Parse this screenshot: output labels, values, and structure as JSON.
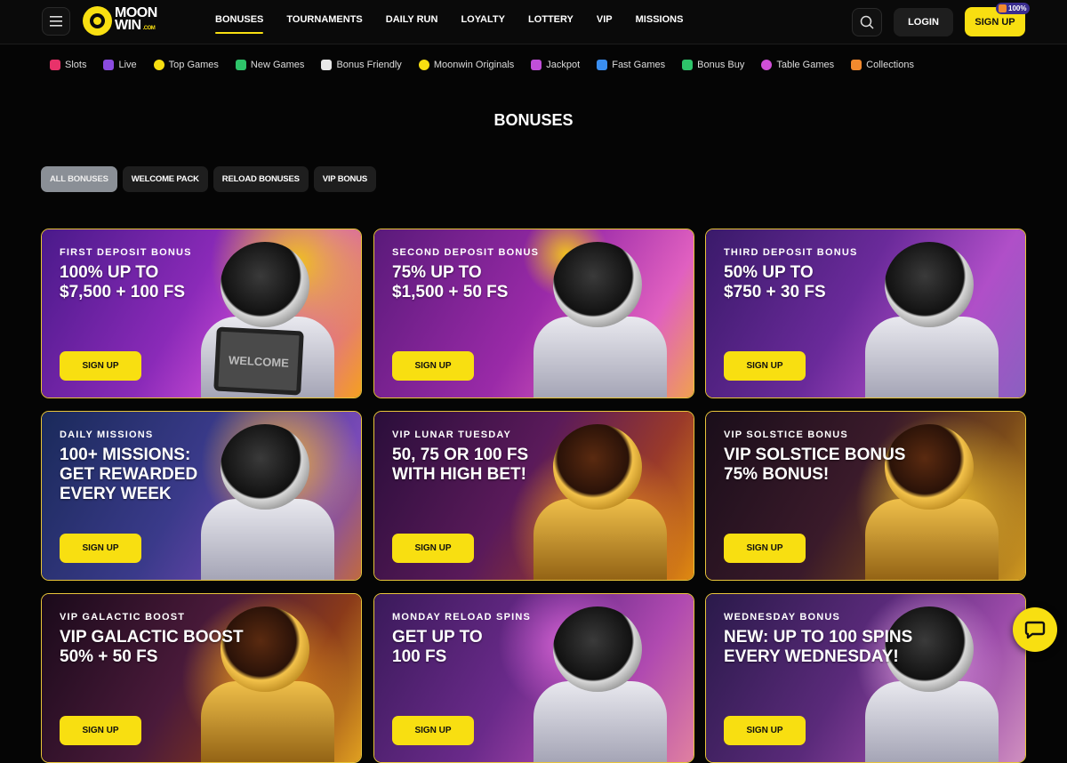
{
  "header": {
    "logo_line1": "MOON",
    "logo_line2": "WIN",
    "logo_suffix": ".COM",
    "nav": [
      {
        "label": "BONUSES",
        "active": true
      },
      {
        "label": "TOURNAMENTS"
      },
      {
        "label": "DAILY RUN"
      },
      {
        "label": "LOYALTY"
      },
      {
        "label": "LOTTERY"
      },
      {
        "label": "VIP"
      },
      {
        "label": "MISSIONS"
      }
    ],
    "login_label": "LOGIN",
    "signup_label": "SIGN UP",
    "signup_badge": "100%"
  },
  "categories": [
    {
      "label": "Slots",
      "icon": "slots-icon",
      "color": "#e8326a"
    },
    {
      "label": "Live",
      "icon": "live-icon",
      "color": "#8a4be0"
    },
    {
      "label": "Top Games",
      "icon": "top-games-icon",
      "color": "#f8df11"
    },
    {
      "label": "New Games",
      "icon": "new-games-icon",
      "color": "#2ec46a"
    },
    {
      "label": "Bonus Friendly",
      "icon": "bonus-friendly-icon",
      "color": "#e8e8e8"
    },
    {
      "label": "Moonwin Originals",
      "icon": "moonwin-originals-icon",
      "color": "#f8df11"
    },
    {
      "label": "Jackpot",
      "icon": "jackpot-icon",
      "color": "#c04fd8"
    },
    {
      "label": "Fast Games",
      "icon": "fast-games-icon",
      "color": "#3a8ef0"
    },
    {
      "label": "Bonus Buy",
      "icon": "bonus-buy-icon",
      "color": "#2ec46a"
    },
    {
      "label": "Table Games",
      "icon": "table-games-icon",
      "color": "#d04fd8"
    },
    {
      "label": "Collections",
      "icon": "collections-icon",
      "color": "#f28a2e"
    }
  ],
  "page_title": "BONUSES",
  "filters": [
    {
      "label": "ALL BONUSES",
      "active": true
    },
    {
      "label": "WELCOME PACK"
    },
    {
      "label": "RELOAD BONUSES"
    },
    {
      "label": "VIP BONUS"
    }
  ],
  "cards": [
    {
      "label": "FIRST DEPOSIT BONUS",
      "title_line1": "100% UP TO",
      "title_line2": "$7,500 + 100 FS",
      "title_line3": "",
      "cta": "SIGN UP",
      "sign": "WELCOME"
    },
    {
      "label": "SECOND DEPOSIT BONUS",
      "title_line1": "75% UP TO",
      "title_line2": "$1,500 + 50 FS",
      "title_line3": "",
      "cta": "SIGN UP"
    },
    {
      "label": "THIRD DEPOSIT BONUS",
      "title_line1": "50% UP TO",
      "title_line2": "$750 + 30 FS",
      "title_line3": "",
      "cta": "SIGN UP"
    },
    {
      "label": "DAILY MISSIONS",
      "title_line1": "100+ MISSIONS:",
      "title_line2": "GET REWARDED",
      "title_line3": "EVERY WEEK",
      "cta": "SIGN UP"
    },
    {
      "label": "VIP LUNAR TUESDAY",
      "title_line1": "50, 75 OR 100 FS",
      "title_line2": "WITH HIGH BET!",
      "title_line3": "",
      "cta": "SIGN UP"
    },
    {
      "label": "VIP SOLSTICE BONUS",
      "title_line1": "VIP SOLSTICE BONUS",
      "title_line2": "75% BONUS!",
      "title_line3": "",
      "cta": "SIGN UP"
    },
    {
      "label": "VIP GALACTIC BOOST",
      "title_line1": "VIP GALACTIC BOOST",
      "title_line2": "50% + 50 FS",
      "title_line3": "",
      "cta": "SIGN UP"
    },
    {
      "label": "MONDAY RELOAD SPINS",
      "title_line1": "GET UP TO",
      "title_line2": "100 FS",
      "title_line3": "",
      "cta": "SIGN UP"
    },
    {
      "label": "WEDNESDAY BONUS",
      "title_line1": "NEW: UP TO 100 SPINS",
      "title_line2": "EVERY WEDNESDAY!",
      "title_line3": "",
      "cta": "SIGN UP"
    }
  ],
  "colors": {
    "accent": "#f8df11",
    "background": "#050505",
    "card_border": "#e8c53a"
  }
}
